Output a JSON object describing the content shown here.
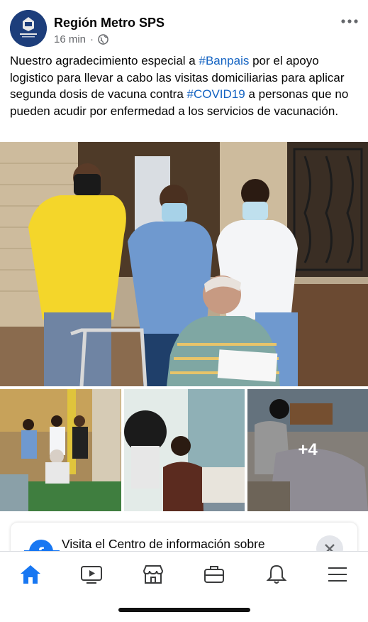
{
  "post": {
    "page_name": "Región Metro SPS",
    "time": "16 min",
    "separator": "·",
    "text_parts": {
      "p1": "Nuestro agradecimiento especial a ",
      "tag1": "#Banpais",
      "p2": " por el apoyo logistico para llevar a cabo las visitas domiciliarias para aplicar segunda dosis de vacuna contra ",
      "tag2": "#COVID19",
      "p3": " a personas que no pueden acudir por enfermedad a  los servicios de vacunación."
    },
    "more_photos": "+4"
  },
  "info_card": {
    "text": "Visita el Centro de información sobre"
  },
  "icons": {
    "avatar": "government-seal-avatar",
    "globe": "globe-icon",
    "more": "more-options-icon",
    "tabs": [
      "home-icon",
      "watch-icon",
      "marketplace-icon",
      "groups-icon",
      "notifications-icon",
      "menu-icon"
    ]
  },
  "colors": {
    "accent": "#1877f2",
    "hashtag": "#1463c2"
  }
}
